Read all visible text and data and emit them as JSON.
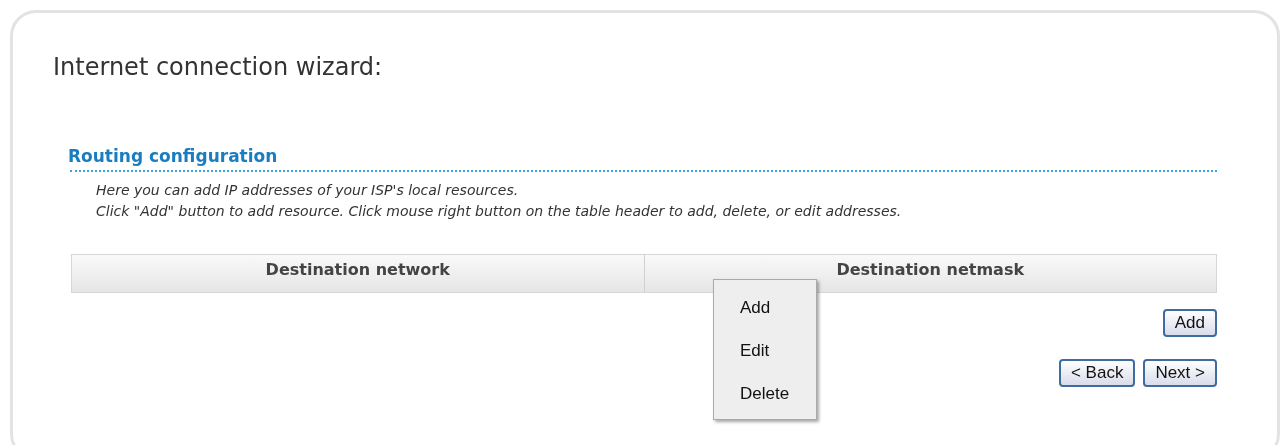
{
  "title": "Internet connection wizard:",
  "section": {
    "heading": "Routing configuration",
    "description": [
      "Here you can add IP addresses of your ISP's local resources.",
      "Click \"Add\" button to add resource. Click mouse right button on the table header to add, delete, or edit addresses."
    ]
  },
  "table": {
    "columns": [
      "Destination network",
      "Destination netmask"
    ]
  },
  "add_button": "Add",
  "buttons": [
    "< Back",
    "Next >"
  ],
  "context_menu": {
    "items": [
      "Add",
      "Edit",
      "Delete"
    ]
  }
}
